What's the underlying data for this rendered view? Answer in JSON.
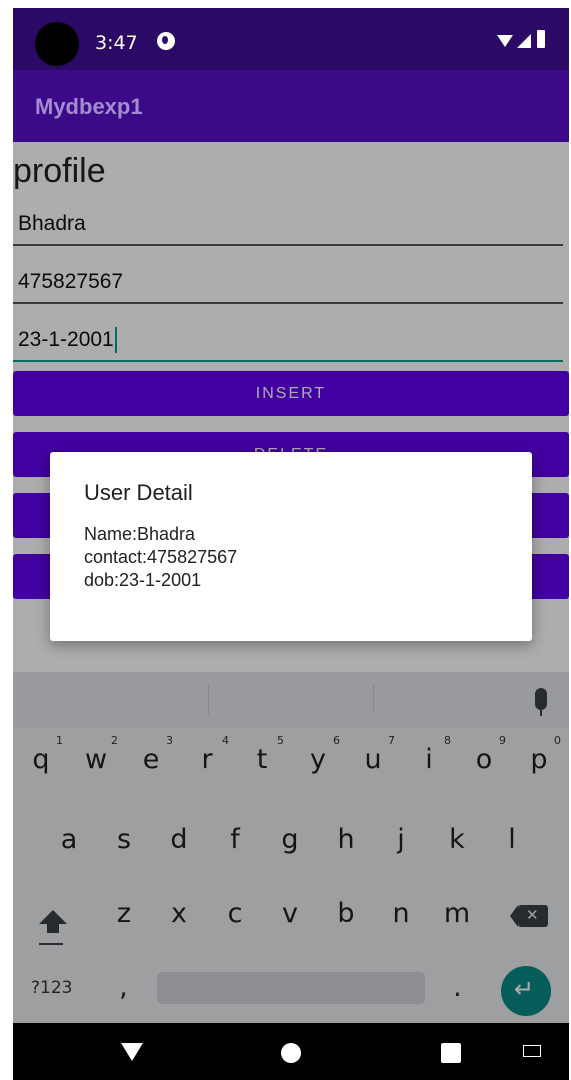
{
  "status_bar": {
    "time": "3:47"
  },
  "app_bar": {
    "title": "Mydbexp1"
  },
  "form": {
    "heading": "profile",
    "name_value": "Bhadra",
    "contact_value": "475827567",
    "dob_value": "23-1-2001"
  },
  "buttons": {
    "insert": "INSERT",
    "delete": "DELETE",
    "update": "",
    "view": ""
  },
  "dialog": {
    "title": "User Detail",
    "line1": "Name:Bhadra",
    "line2": "contact:475827567",
    "line3": "dob:23-1-2001"
  },
  "keyboard": {
    "row1": [
      "q",
      "w",
      "e",
      "r",
      "t",
      "y",
      "u",
      "i",
      "o",
      "p"
    ],
    "row1_numbers": [
      "1",
      "2",
      "3",
      "4",
      "5",
      "6",
      "7",
      "8",
      "9",
      "0"
    ],
    "row2": [
      "a",
      "s",
      "d",
      "f",
      "g",
      "h",
      "j",
      "k",
      "l"
    ],
    "row3": [
      "z",
      "x",
      "c",
      "v",
      "b",
      "n",
      "m"
    ],
    "symbols_key": "?123",
    "comma": ",",
    "period": "."
  },
  "colors": {
    "status_bar": "#2b0a66",
    "app_bar": "#3a0a88",
    "button": "#6200ee",
    "accent": "#00a092"
  }
}
